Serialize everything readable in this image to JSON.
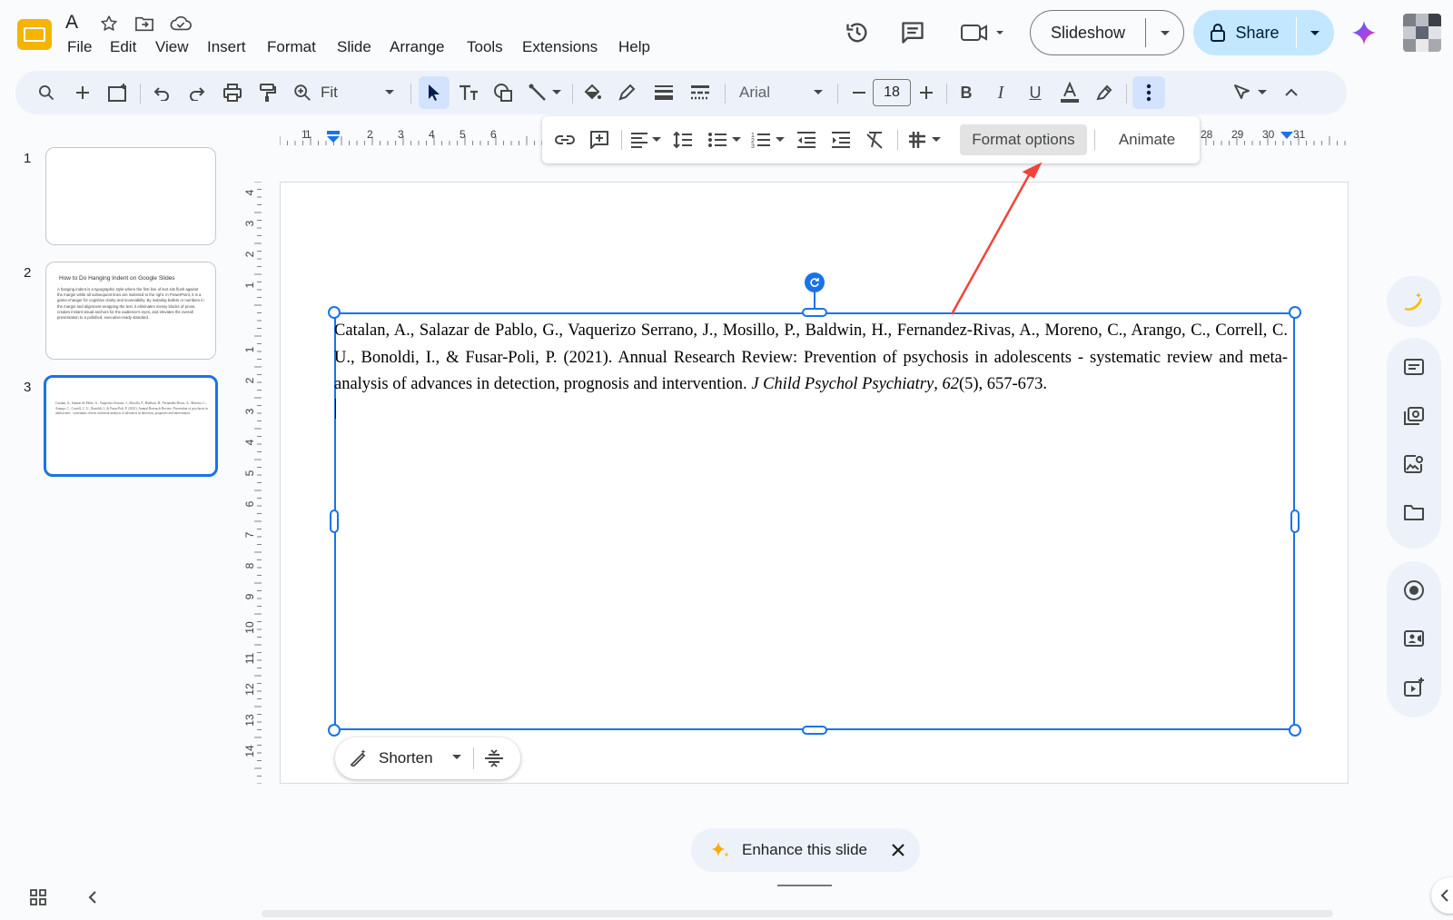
{
  "doc": {
    "title_initial": "A"
  },
  "menu": [
    "File",
    "Edit",
    "View",
    "Insert",
    "Format",
    "Slide",
    "Arrange",
    "Tools",
    "Extensions",
    "Help"
  ],
  "header": {
    "slideshow_label": "Slideshow",
    "share_label": "Share"
  },
  "toolbar": {
    "zoom_value": "Fit",
    "font_family": "Arial",
    "font_size": "18"
  },
  "floatbar": {
    "format_options_label": "Format options",
    "animate_label": "Animate"
  },
  "filmstrip": {
    "slides": [
      {
        "number": "1"
      },
      {
        "number": "2",
        "title": "How to Do Hanging Indent on Google Slides",
        "body": "A hanging indent is a typographic style where the first line of text sits flush against the margin while all subsequent lines are indented to the right. In PowerPoint, it is a game-changer for cognitive clarity and scannability. By isolating bullets or numbers in the margin and alignment-wrapping the text, it eliminates messy blocks of prose, creates instant visual anchors for the audience's eyes, and elevates the overall presentation to a polished, executive-ready standard."
      },
      {
        "number": "3"
      }
    ]
  },
  "citation": {
    "part1": "Catalan, A., Salazar de Pablo, G., Vaquerizo Serrano, J., Mosillo, P., Baldwin, H., Fernandez-Rivas, A., Moreno, C., Arango, C., Correll, C. U., Bonoldi, I., & Fusar-Poli, P. (2021). Annual Research Review: Prevention of psychosis in adolescents - systematic review and meta-analysis of advances in detection, prognosis and intervention.",
    "journal": "J Child Psychol Psychiatry",
    "comma": ", ",
    "volume": "62",
    "rest": "(5), 657-673."
  },
  "ruler": {
    "h_ticks": [
      "1",
      "1",
      "2",
      "3",
      "4",
      "5",
      "6",
      "28",
      "29",
      "30",
      "31"
    ],
    "v_ticks": [
      "4",
      "3",
      "2",
      "1",
      "1",
      "2",
      "3",
      "4",
      "5",
      "6",
      "7",
      "8",
      "9",
      "10",
      "11",
      "12",
      "13",
      "14"
    ]
  },
  "ai_chip": {
    "shorten_label": "Shorten"
  },
  "enhance": {
    "label": "Enhance this slide"
  },
  "colors": {
    "accent": "#1a73e8",
    "share_bg": "#c2e7ff",
    "toolbar_bg": "#edf2fa",
    "arrow": "#f0443a"
  }
}
